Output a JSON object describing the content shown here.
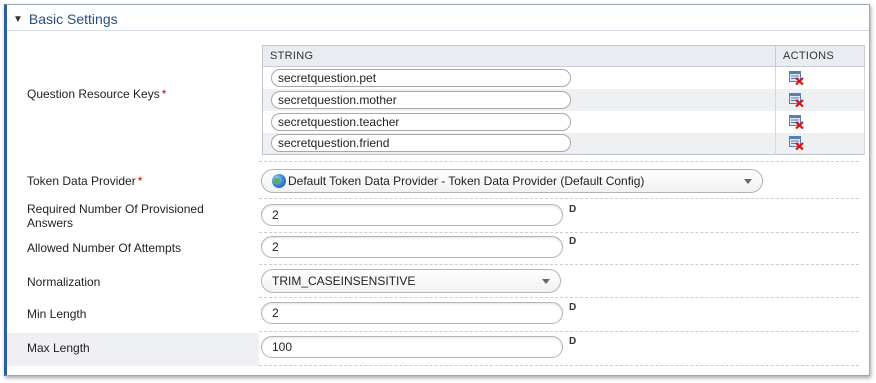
{
  "section": {
    "title": "Basic Settings"
  },
  "question_keys": {
    "label": "Question Resource Keys",
    "required_mark": "*",
    "columns": {
      "string": "STRING",
      "actions": "ACTIONS"
    },
    "rows": [
      {
        "value": "secretquestion.pet"
      },
      {
        "value": "secretquestion.mother"
      },
      {
        "value": "secretquestion.teacher"
      },
      {
        "value": "secretquestion.friend"
      }
    ],
    "delete_icon": "delete-row-icon"
  },
  "token_provider": {
    "label": "Token Data Provider",
    "required_mark": "*",
    "value": "Default Token Data Provider - Token Data Provider (Default Config)",
    "icon": "globe-icon"
  },
  "provisioned_answers": {
    "label": "Required Number Of Provisioned Answers",
    "value": "2",
    "flag": "D"
  },
  "attempts": {
    "label": "Allowed Number Of Attempts",
    "value": "2",
    "flag": "D"
  },
  "normalization": {
    "label": "Normalization",
    "value": "TRIM_CASEINSENSITIVE"
  },
  "min_length": {
    "label": "Min Length",
    "value": "2",
    "flag": "D"
  },
  "max_length": {
    "label": "Max Length",
    "value": "100",
    "flag": "D"
  },
  "colors": {
    "accent": "#2b5f9e",
    "title": "#274e84",
    "required": "#cc0000"
  }
}
